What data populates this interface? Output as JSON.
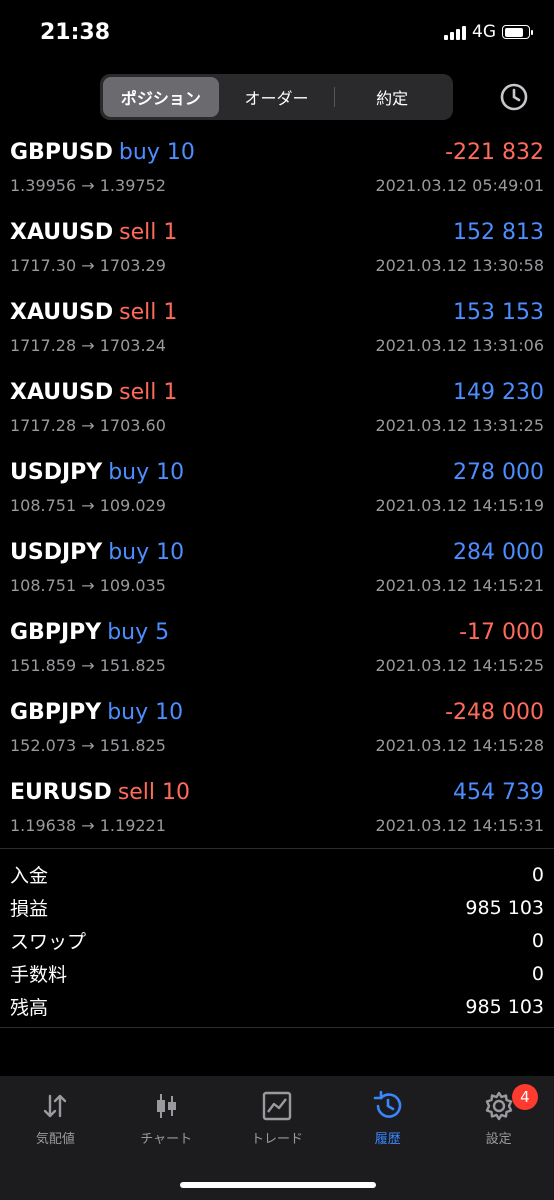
{
  "status": {
    "time": "21:38",
    "network": "4G"
  },
  "segments": [
    {
      "label": "ポジション",
      "active": true
    },
    {
      "label": "オーダー",
      "active": false
    },
    {
      "label": "約定",
      "active": false
    }
  ],
  "trades": [
    {
      "symbol": "GBPUSD",
      "side": "buy 10",
      "type": "buy",
      "profit": "-221 832",
      "sign": "neg",
      "prices": "1.39956 → 1.39752",
      "time": "2021.03.12 05:49:01"
    },
    {
      "symbol": "XAUUSD",
      "side": "sell 1",
      "type": "sell",
      "profit": "152 813",
      "sign": "pos",
      "prices": "1717.30 → 1703.29",
      "time": "2021.03.12 13:30:58"
    },
    {
      "symbol": "XAUUSD",
      "side": "sell 1",
      "type": "sell",
      "profit": "153 153",
      "sign": "pos",
      "prices": "1717.28 → 1703.24",
      "time": "2021.03.12 13:31:06"
    },
    {
      "symbol": "XAUUSD",
      "side": "sell 1",
      "type": "sell",
      "profit": "149 230",
      "sign": "pos",
      "prices": "1717.28 → 1703.60",
      "time": "2021.03.12 13:31:25"
    },
    {
      "symbol": "USDJPY",
      "side": "buy 10",
      "type": "buy",
      "profit": "278 000",
      "sign": "pos",
      "prices": "108.751 → 109.029",
      "time": "2021.03.12 14:15:19"
    },
    {
      "symbol": "USDJPY",
      "side": "buy 10",
      "type": "buy",
      "profit": "284 000",
      "sign": "pos",
      "prices": "108.751 → 109.035",
      "time": "2021.03.12 14:15:21"
    },
    {
      "symbol": "GBPJPY",
      "side": "buy 5",
      "type": "buy",
      "profit": "-17 000",
      "sign": "neg",
      "prices": "151.859 → 151.825",
      "time": "2021.03.12 14:15:25"
    },
    {
      "symbol": "GBPJPY",
      "side": "buy 10",
      "type": "buy",
      "profit": "-248 000",
      "sign": "neg",
      "prices": "152.073 → 151.825",
      "time": "2021.03.12 14:15:28"
    },
    {
      "symbol": "EURUSD",
      "side": "sell 10",
      "type": "sell",
      "profit": "454 739",
      "sign": "pos",
      "prices": "1.19638 → 1.19221",
      "time": "2021.03.12 14:15:31"
    }
  ],
  "summary": [
    {
      "label": "入金",
      "value": "0"
    },
    {
      "label": "損益",
      "value": "985 103"
    },
    {
      "label": "スワップ",
      "value": "0"
    },
    {
      "label": "手数料",
      "value": "0"
    },
    {
      "label": "残高",
      "value": "985 103"
    }
  ],
  "tabs": [
    {
      "label": "気配値",
      "icon": "quotes-arrows-icon",
      "active": false
    },
    {
      "label": "チャート",
      "icon": "candlestick-chart-icon",
      "active": false
    },
    {
      "label": "トレード",
      "icon": "trade-chart-icon",
      "active": false
    },
    {
      "label": "履歴",
      "icon": "history-clock-icon",
      "active": true
    },
    {
      "label": "設定",
      "icon": "gear-icon",
      "active": false,
      "badge": "4"
    }
  ],
  "colors": {
    "buy": "#4c8dff",
    "sell": "#ff6b5b",
    "active_tab": "#3a86ff"
  }
}
